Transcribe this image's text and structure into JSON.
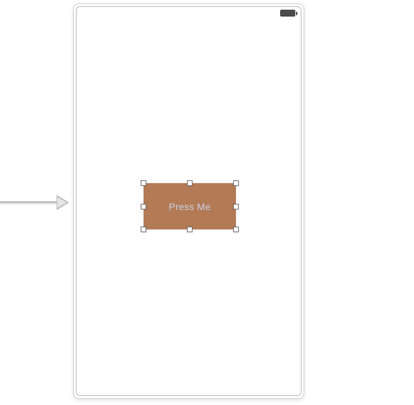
{
  "button": {
    "label": "Press Me",
    "bg_color": "#b37a56",
    "text_color": "#c7d2e6"
  },
  "status": {
    "battery_level": "full"
  }
}
